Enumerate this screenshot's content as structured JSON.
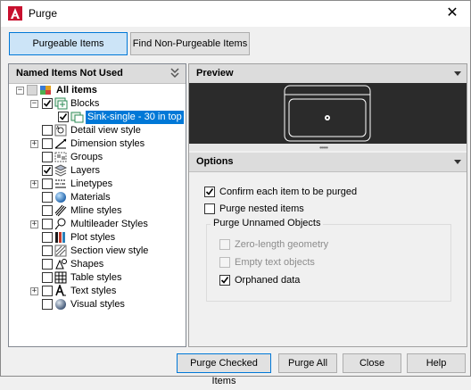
{
  "window": {
    "title": "Purge",
    "close_glyph": "✕"
  },
  "tabs": [
    {
      "label": "Purgeable Items",
      "active": true
    },
    {
      "label": "Find Non-Purgeable Items",
      "active": false
    }
  ],
  "left_panel": {
    "title": "Named Items Not Used",
    "tree": [
      {
        "label": "All items",
        "bold": true,
        "expander": "−",
        "checkbox": "partial",
        "icon": "all-items-icon"
      },
      {
        "label": "Blocks",
        "expander": "−",
        "checkbox": "checked",
        "icon": "blocks-icon"
      },
      {
        "label": "Sink-single - 30 in top",
        "selected": true,
        "checkbox": "checked",
        "icon": "block-item-icon"
      },
      {
        "label": "Detail view style",
        "checkbox": "unchecked",
        "icon": "detail-view-style-icon"
      },
      {
        "label": "Dimension styles",
        "expander": "+",
        "checkbox": "unchecked",
        "icon": "dimension-styles-icon"
      },
      {
        "label": "Groups",
        "checkbox": "unchecked",
        "icon": "groups-icon"
      },
      {
        "label": "Layers",
        "checkbox": "checked",
        "icon": "layers-icon"
      },
      {
        "label": "Linetypes",
        "expander": "+",
        "checkbox": "unchecked",
        "icon": "linetypes-icon"
      },
      {
        "label": "Materials",
        "checkbox": "unchecked",
        "icon": "materials-icon"
      },
      {
        "label": "Mline styles",
        "checkbox": "unchecked",
        "icon": "mline-styles-icon"
      },
      {
        "label": "Multileader Styles",
        "expander": "+",
        "checkbox": "unchecked",
        "icon": "multileader-styles-icon"
      },
      {
        "label": "Plot styles",
        "checkbox": "unchecked",
        "icon": "plot-styles-icon"
      },
      {
        "label": "Section view style",
        "checkbox": "unchecked",
        "icon": "section-view-style-icon"
      },
      {
        "label": "Shapes",
        "checkbox": "unchecked",
        "icon": "shapes-icon"
      },
      {
        "label": "Table styles",
        "checkbox": "unchecked",
        "icon": "table-styles-icon"
      },
      {
        "label": "Text styles",
        "expander": "+",
        "checkbox": "unchecked",
        "icon": "text-styles-icon"
      },
      {
        "label": "Visual styles",
        "checkbox": "unchecked",
        "icon": "visual-styles-icon"
      }
    ]
  },
  "preview": {
    "title": "Preview"
  },
  "options": {
    "title": "Options",
    "confirm_each": {
      "label": "Confirm each item to be purged",
      "checked": true
    },
    "purge_nested": {
      "label": "Purge nested items",
      "checked": false
    },
    "unnamed_group": {
      "title": "Purge Unnamed Objects",
      "zero_length": {
        "label": "Zero-length geometry",
        "checked": false,
        "disabled": true
      },
      "empty_text": {
        "label": "Empty text objects",
        "checked": false,
        "disabled": true
      },
      "orphaned": {
        "label": "Orphaned data",
        "checked": true,
        "disabled": false
      }
    }
  },
  "buttons": {
    "purge_checked": "Purge Checked Items",
    "purge_all": "Purge All",
    "close": "Close",
    "help": "Help"
  },
  "colors": {
    "accent": "#0078d7",
    "selected_tab": "#cce4f7",
    "preview_bg": "#2b2b2b"
  }
}
